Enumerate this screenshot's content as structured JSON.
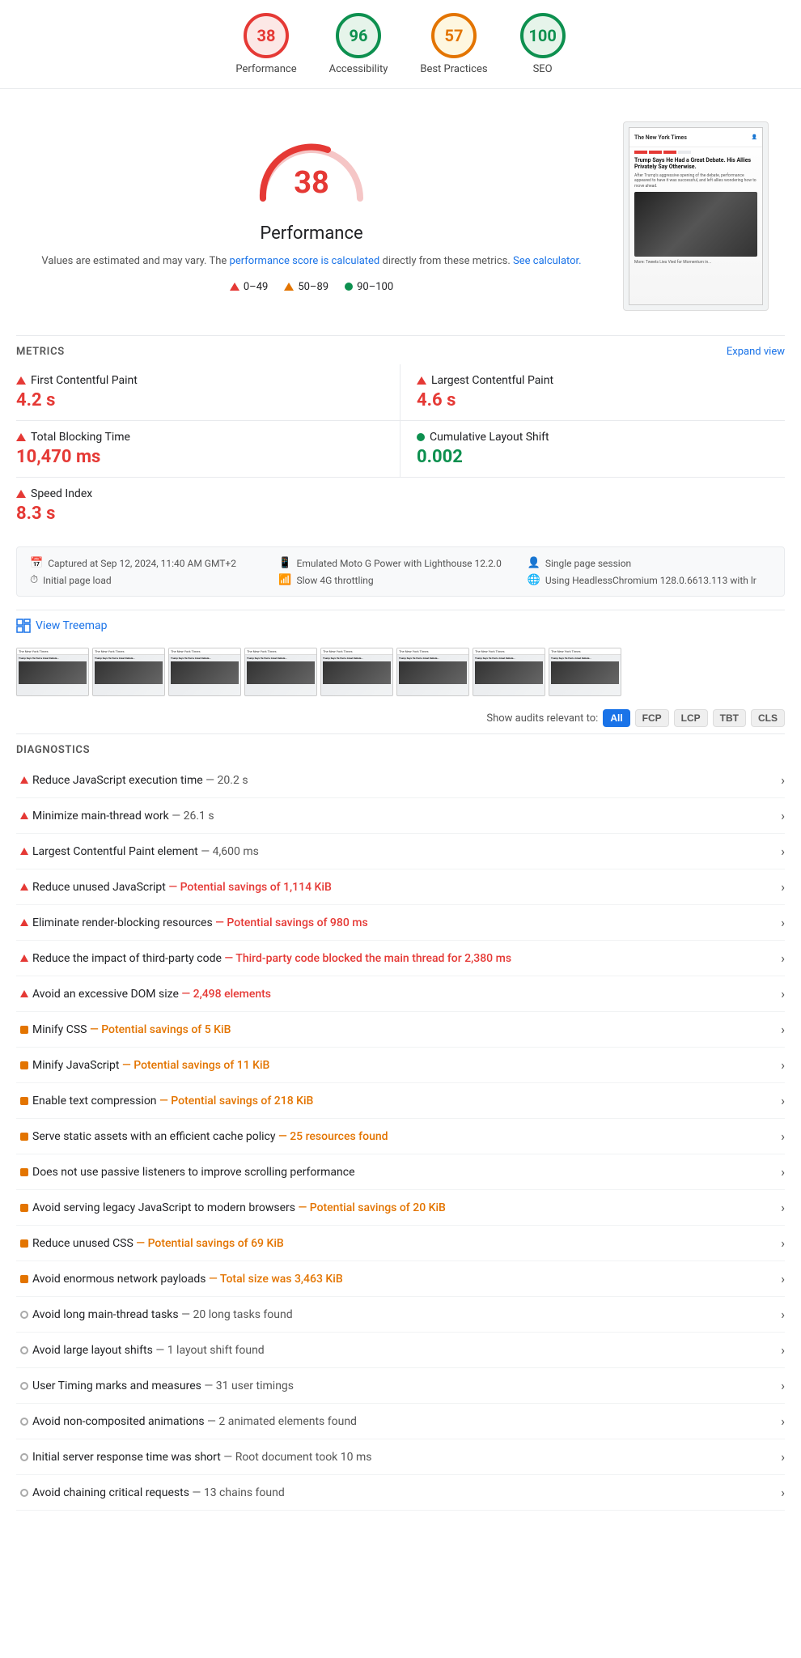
{
  "scores": [
    {
      "id": "performance",
      "label": "Performance",
      "value": "38",
      "type": "red"
    },
    {
      "id": "accessibility",
      "label": "Accessibility",
      "value": "96",
      "type": "green"
    },
    {
      "id": "best-practices",
      "label": "Best Practices",
      "value": "57",
      "type": "orange"
    },
    {
      "id": "seo",
      "label": "SEO",
      "value": "100",
      "type": "green"
    }
  ],
  "performance": {
    "score": "38",
    "title": "Performance",
    "description": "Values are estimated and may vary. The",
    "link_text": "performance score is calculated",
    "description2": "directly from these metrics.",
    "link2_text": "See calculator.",
    "legend": {
      "items": [
        {
          "label": "0–49",
          "type": "triangle-red"
        },
        {
          "label": "50–89",
          "type": "triangle-orange"
        },
        {
          "label": "90–100",
          "type": "circle-green"
        }
      ]
    }
  },
  "metrics_section": {
    "title": "METRICS",
    "expand_label": "Expand view"
  },
  "metrics": [
    {
      "label": "First Contentful Paint",
      "value": "4.2 s",
      "color": "red",
      "icon": "triangle"
    },
    {
      "label": "Largest Contentful Paint",
      "value": "4.6 s",
      "color": "red",
      "icon": "triangle"
    },
    {
      "label": "Total Blocking Time",
      "value": "10,470 ms",
      "color": "red",
      "icon": "triangle"
    },
    {
      "label": "Cumulative Layout Shift",
      "value": "0.002",
      "color": "green",
      "icon": "circle"
    },
    {
      "label": "Speed Index",
      "value": "8.3 s",
      "color": "red",
      "icon": "triangle"
    }
  ],
  "capture": {
    "items": [
      {
        "icon": "📅",
        "text": "Captured at Sep 12, 2024, 11:40 AM GMT+2"
      },
      {
        "icon": "📱",
        "text": "Emulated Moto G Power with Lighthouse 12.2.0"
      },
      {
        "icon": "👤",
        "text": "Single page session"
      },
      {
        "icon": "⏱",
        "text": "Initial page load"
      },
      {
        "icon": "📶",
        "text": "Slow 4G throttling"
      },
      {
        "icon": "🌐",
        "text": "Using HeadlessChromium 128.0.6613.113 with lr"
      }
    ]
  },
  "treemap": {
    "label": "View Treemap"
  },
  "filter": {
    "label": "Show audits relevant to:",
    "buttons": [
      {
        "label": "All",
        "active": true
      },
      {
        "label": "FCP",
        "active": false
      },
      {
        "label": "LCP",
        "active": false
      },
      {
        "label": "TBT",
        "active": false
      },
      {
        "label": "CLS",
        "active": false
      }
    ]
  },
  "diagnostics_title": "DIAGNOSTICS",
  "audits": [
    {
      "type": "triangle",
      "text": "Reduce JavaScript execution time",
      "detail": "— 20.2 s",
      "detail_color": "normal"
    },
    {
      "type": "triangle",
      "text": "Minimize main-thread work",
      "detail": "— 26.1 s",
      "detail_color": "normal"
    },
    {
      "type": "triangle",
      "text": "Largest Contentful Paint element",
      "detail": "— 4,600 ms",
      "detail_color": "normal"
    },
    {
      "type": "triangle",
      "text": "Reduce unused JavaScript",
      "detail": "— Potential savings of 1,114 KiB",
      "detail_color": "highlight"
    },
    {
      "type": "triangle",
      "text": "Eliminate render-blocking resources",
      "detail": "— Potential savings of 980 ms",
      "detail_color": "highlight"
    },
    {
      "type": "triangle",
      "text": "Reduce the impact of third-party code",
      "detail": "— Third-party code blocked the main thread for 2,380 ms",
      "detail_color": "highlight"
    },
    {
      "type": "triangle",
      "text": "Avoid an excessive DOM size",
      "detail": "— 2,498 elements",
      "detail_color": "highlight"
    },
    {
      "type": "square",
      "text": "Minify CSS",
      "detail": "— Potential savings of 5 KiB",
      "detail_color": "orange"
    },
    {
      "type": "square",
      "text": "Minify JavaScript",
      "detail": "— Potential savings of 11 KiB",
      "detail_color": "orange"
    },
    {
      "type": "square",
      "text": "Enable text compression",
      "detail": "— Potential savings of 218 KiB",
      "detail_color": "orange"
    },
    {
      "type": "square",
      "text": "Serve static assets with an efficient cache policy",
      "detail": "— 25 resources found",
      "detail_color": "orange"
    },
    {
      "type": "square",
      "text": "Does not use passive listeners to improve scrolling performance",
      "detail": "",
      "detail_color": "normal"
    },
    {
      "type": "square",
      "text": "Avoid serving legacy JavaScript to modern browsers",
      "detail": "— Potential savings of 20 KiB",
      "detail_color": "orange"
    },
    {
      "type": "square",
      "text": "Reduce unused CSS",
      "detail": "— Potential savings of 69 KiB",
      "detail_color": "orange"
    },
    {
      "type": "square",
      "text": "Avoid enormous network payloads",
      "detail": "— Total size was 3,463 KiB",
      "detail_color": "orange"
    },
    {
      "type": "circle",
      "text": "Avoid long main-thread tasks",
      "detail": "— 20 long tasks found",
      "detail_color": "normal"
    },
    {
      "type": "circle",
      "text": "Avoid large layout shifts",
      "detail": "— 1 layout shift found",
      "detail_color": "normal"
    },
    {
      "type": "circle",
      "text": "User Timing marks and measures",
      "detail": "— 31 user timings",
      "detail_color": "normal"
    },
    {
      "type": "circle",
      "text": "Avoid non-composited animations",
      "detail": "— 2 animated elements found",
      "detail_color": "normal"
    },
    {
      "type": "circle",
      "text": "Initial server response time was short",
      "detail": "— Root document took 10 ms",
      "detail_color": "normal"
    },
    {
      "type": "circle",
      "text": "Avoid chaining critical requests",
      "detail": "— 13 chains found",
      "detail_color": "normal"
    }
  ]
}
